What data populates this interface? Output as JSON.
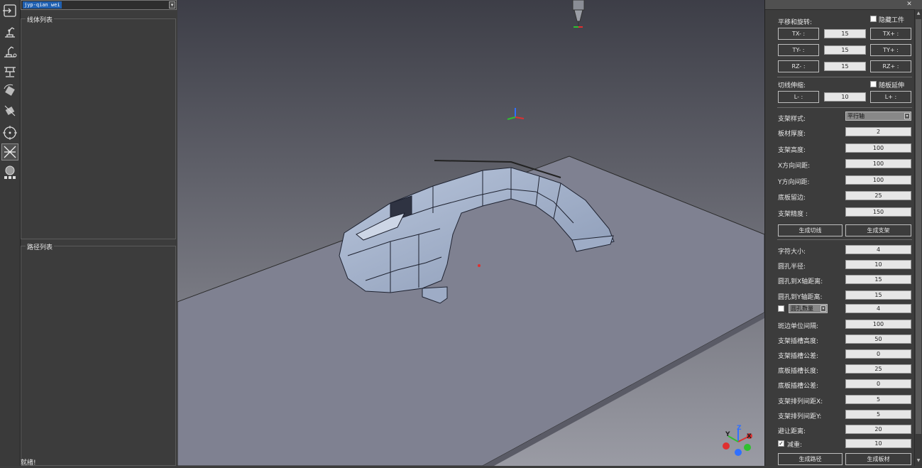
{
  "left": {
    "combo_value": "jyp-qian wei",
    "line_list_title": "线体列表",
    "path_list_title": "路径列表",
    "status": "就绪!"
  },
  "toolbar": [
    "import-icon",
    "robot-arm-icon",
    "robot-arm-2-icon",
    "fixture-icon",
    "part-rotate-icon",
    "part-rotate-2-icon",
    "target-icon",
    "cut-line-icon",
    "material-icon"
  ],
  "right": {
    "close": "✕",
    "move_rotate": {
      "title": "平移和旋转:",
      "hide_part_label": "隐藏工件",
      "rows": [
        {
          "minus": "TX- :",
          "value": "15",
          "plus": "TX+ :"
        },
        {
          "minus": "TY- :",
          "value": "15",
          "plus": "TY+ :"
        },
        {
          "minus": "RZ- :",
          "value": "15",
          "plus": "RZ+ :"
        }
      ]
    },
    "tangent": {
      "title": "切线伸缩:",
      "follow_label": "随板延伸",
      "minus": "L- :",
      "value": "10",
      "plus": "L+ :"
    },
    "bracket": {
      "style_label": "支架样式:",
      "style_value": "平行轴",
      "fields": [
        {
          "label": "板材厚度:",
          "value": "2"
        },
        {
          "label": "支架高度:",
          "value": "100"
        },
        {
          "label": "X方向间距:",
          "value": "100"
        },
        {
          "label": "Y方向间距:",
          "value": "100"
        },
        {
          "label": "底板留边:",
          "value": "25"
        },
        {
          "label": "支架精度 :",
          "value": "150"
        }
      ],
      "gen_cut_line": "生成切线",
      "gen_bracket": "生成支架"
    },
    "params": {
      "fields_a": [
        {
          "label": "字符大小:",
          "value": "4"
        },
        {
          "label": "圆孔半径:",
          "value": "10"
        },
        {
          "label": "圆孔到X轴距离:",
          "value": "15"
        },
        {
          "label": "圆孔到Y轴距离:",
          "value": "15"
        }
      ],
      "hole_count_label": "圆孔数量",
      "hole_count_value": "4",
      "fields_b": [
        {
          "label": "斑边单位间隔:",
          "value": "100"
        },
        {
          "label": "支架插槽高度:",
          "value": "50"
        },
        {
          "label": "支架插槽公差:",
          "value": "0"
        },
        {
          "label": "底板插槽长度:",
          "value": "25"
        },
        {
          "label": "底板插槽公差:",
          "value": "0"
        },
        {
          "label": "支架排列间距X:",
          "value": "5"
        },
        {
          "label": "支架排列间距Y:",
          "value": "5"
        },
        {
          "label": "避让距离:",
          "value": "20"
        }
      ],
      "reduce_label": "减重:",
      "reduce_value": "10",
      "gen_path": "生成路径",
      "gen_board": "生成板材"
    }
  },
  "viewport": {
    "axis_labels": {
      "x": "X",
      "y": "Y",
      "z": "Z"
    },
    "colors": {
      "x": "#e03030",
      "y": "#30c030",
      "z": "#3070ff",
      "part": "#a9b8d0",
      "floor": "#7e8190"
    }
  }
}
